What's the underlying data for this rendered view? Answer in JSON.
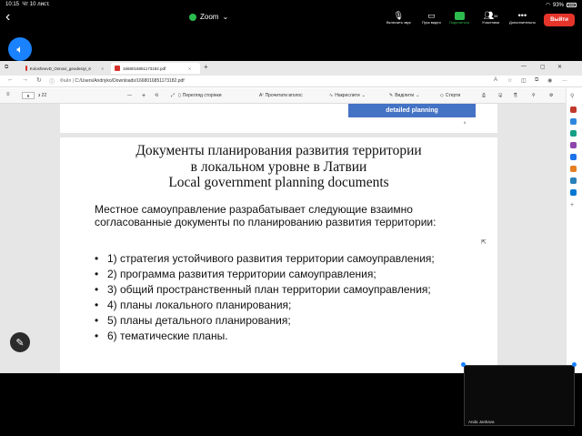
{
  "status_bar": {
    "time": "10:15",
    "date": "Чт 10 лист.",
    "battery": "93%"
  },
  "meeting": {
    "title": "Zoom",
    "leave_label": "Выйти"
  },
  "toolbar": {
    "mute_label": "Включить звук",
    "video_label": "Пуск видео",
    "share_label": "Поделиться",
    "participants_label": "Участники",
    "participants_count": "34",
    "more_label": "Дополнительно"
  },
  "browser": {
    "tabs": [
      {
        "label": "KolosheevD_Osnovi_geodesiyi_K"
      },
      {
        "label": "1668016851173182.pdf"
      }
    ],
    "url_prefix": "Файл",
    "url": "C:/Users/Andriyko/Downloads/1668016851173182.pdf"
  },
  "pdf_toolbar": {
    "page_current": "9",
    "page_total": "з 22",
    "zoom_minus": "—",
    "zoom_plus": "+",
    "view_label": "Перегляд сторінки",
    "read_label": "Прочитати вголос",
    "draw_label": "Накреслити",
    "highlight_label": "Виділити",
    "erase_label": "Стерти"
  },
  "prev_page": {
    "box_text": "detailed planning",
    "page_num": "8"
  },
  "slide": {
    "title_line1": "Документы планирования развития территории",
    "title_line2": "в локальном уровне в Латвии",
    "title_line3": "Local government planning documents",
    "intro": "Местное самоуправление разрабатывает следующие взаимно согласованные документы по планированию развития территории:",
    "bullets": [
      "1) стратегия устойчивого развития территории самоуправления;",
      "2) программа развития территории самоуправления;",
      "3) общий пространственный план территории самоуправления;",
      "4) планы локального планирования;",
      "5) планы детального планирования;",
      "6) тематические планы."
    ]
  },
  "video": {
    "participant_name": "Anda Jankava"
  }
}
